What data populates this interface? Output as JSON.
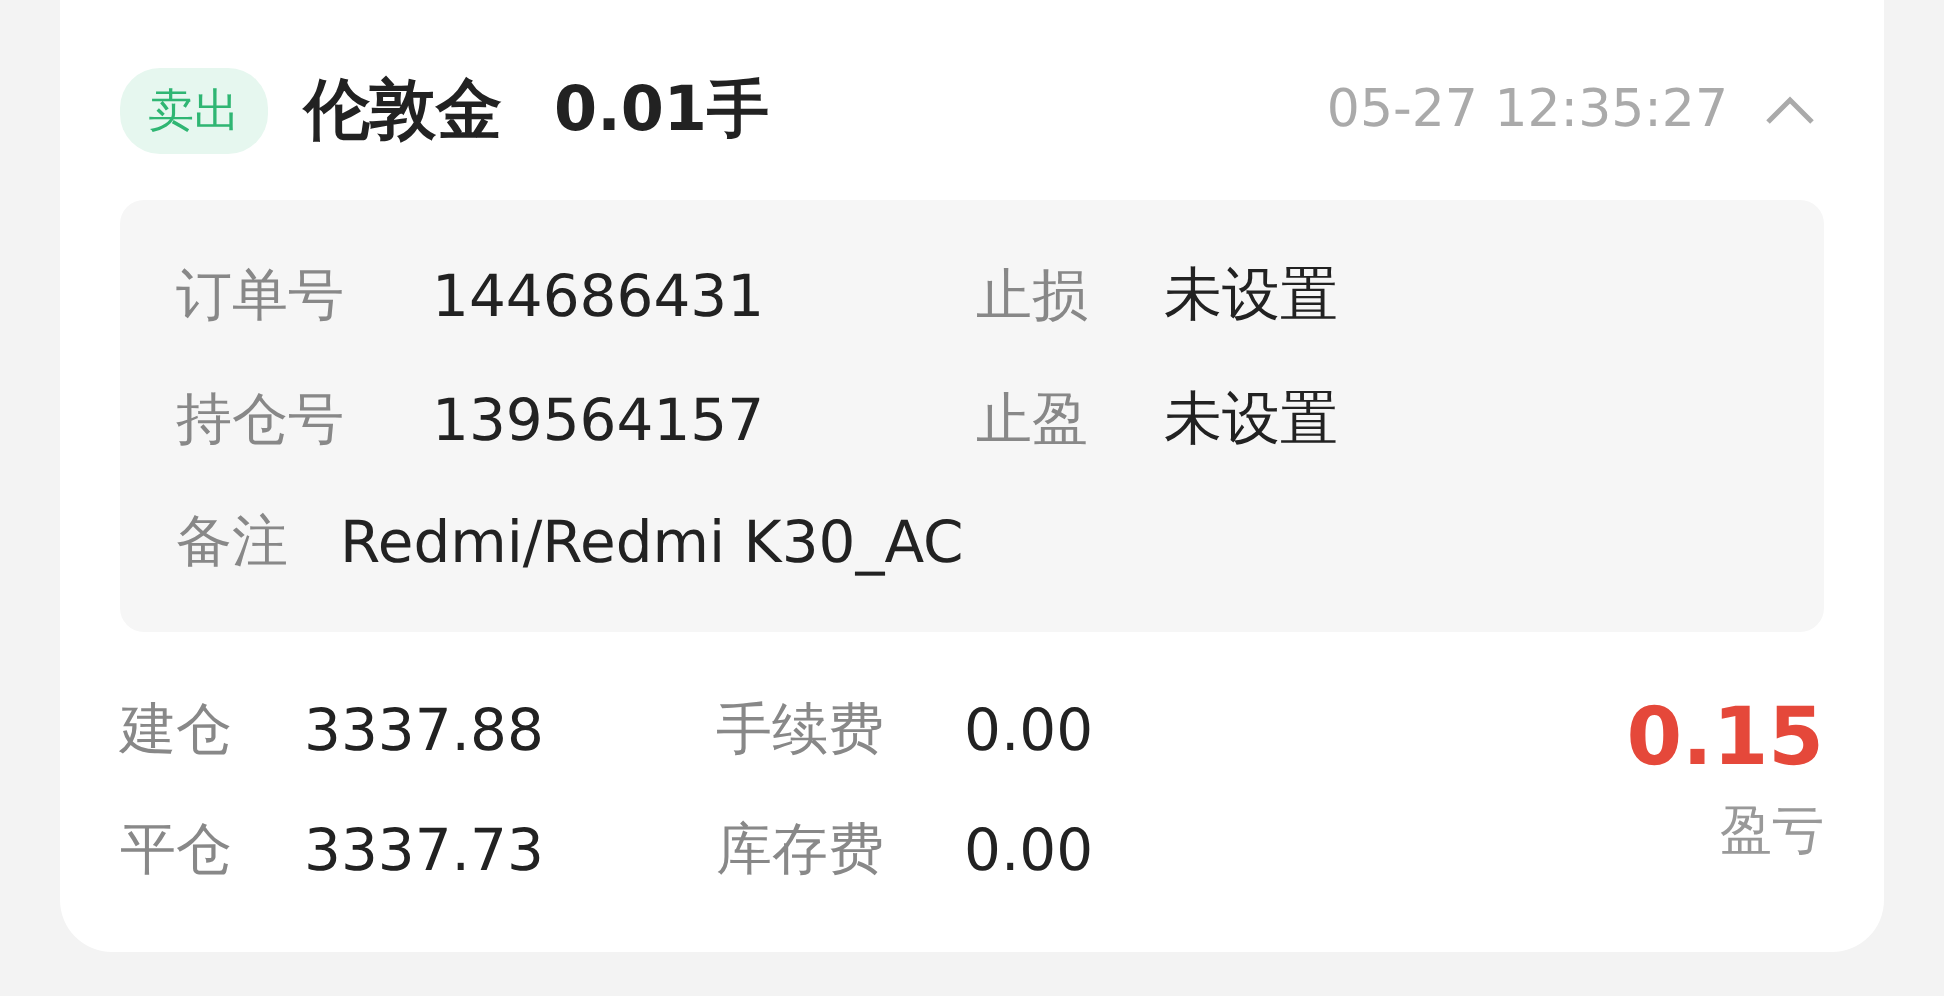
{
  "order": {
    "side": "卖出",
    "symbol": "伦敦金",
    "lots": "0.01手",
    "time": "05-27 12:35:27",
    "expanded": true
  },
  "details": [
    {
      "label": "订单号",
      "value": "144686431"
    },
    {
      "label": "止损",
      "value": "未设置"
    },
    {
      "label": "持仓号",
      "value": "139564157"
    },
    {
      "label": "止盈",
      "value": "未设置"
    }
  ],
  "note": {
    "label": "备注",
    "value": "Redmi/Redmi K30_AC"
  },
  "summary": [
    {
      "label": "建仓",
      "value": "3337.88"
    },
    {
      "label": "手续费",
      "value": "0.00"
    },
    {
      "label": "平仓",
      "value": "3337.73"
    },
    {
      "label": "库存费",
      "value": "0.00"
    }
  ],
  "profit": {
    "value": "0.15",
    "label": "盈亏"
  }
}
